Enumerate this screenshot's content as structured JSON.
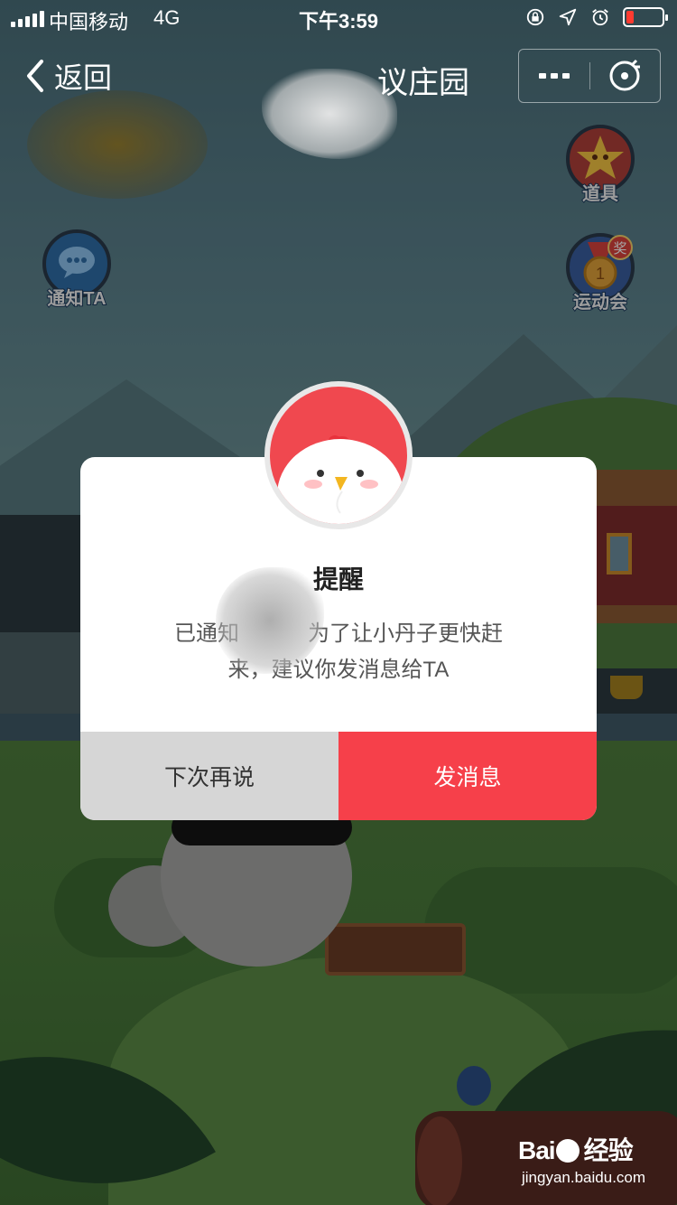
{
  "status_bar": {
    "carrier": "中国移动",
    "network": "4G",
    "time": "下午3:59",
    "icons": [
      "orientation-lock-icon",
      "location-icon",
      "alarm-icon",
      "battery-low-icon"
    ],
    "battery_color": "#ff3b30"
  },
  "nav": {
    "back_label": "返回",
    "title_visible": "议庄园",
    "more_icon": "more-dots-icon",
    "close_icon": "close-target-icon"
  },
  "game_icons": {
    "notify_label": "通知TA",
    "tools_label": "道具",
    "sports_label": "运动会",
    "sports_badge": "奖"
  },
  "dialog": {
    "title": "提醒",
    "message_line1": "已通知",
    "message_line1_rest": "为了让小丹子更快赶",
    "message_line2": "来，建议你发消息给TA",
    "later_button": "下次再说",
    "send_button": "发消息",
    "colors": {
      "send_bg": "#f6404a",
      "later_bg": "#d6d6d6",
      "avatar_bg": "#f0484f"
    }
  },
  "watermark": {
    "logo_left": "Bai",
    "logo_right": "经验",
    "url": "jingyan.baidu.com"
  }
}
